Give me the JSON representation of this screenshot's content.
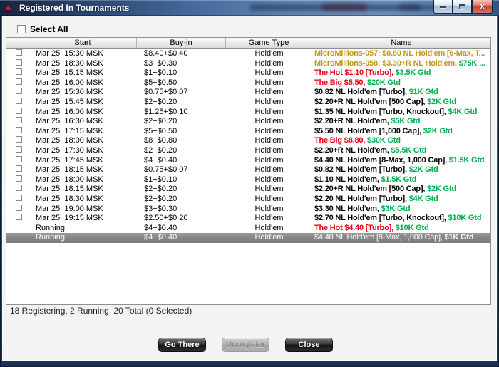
{
  "window": {
    "title": "Registered In Tournaments",
    "icon": "red-spade",
    "controls": {
      "minimize": "minimize",
      "maximize": "maximize",
      "close": "x"
    }
  },
  "select_all_label": "Select All",
  "table": {
    "columns": [
      "",
      "Start",
      "Buy-in",
      "Game Type",
      "Name"
    ],
    "rows": [
      {
        "checkbox": true,
        "selected": false,
        "start": "Mar 25  15:30 MSK",
        "buyin": "$8.40+$0.40",
        "game": "Hold'em",
        "name": [
          {
            "t": "MicroMillions-057: $8.80 NL Hold'em [6-Max, T...",
            "c": "gold"
          }
        ]
      },
      {
        "checkbox": true,
        "selected": false,
        "start": "Mar 25  18:30 MSK",
        "buyin": "$3+$0.30",
        "game": "Hold'em",
        "name": [
          {
            "t": "MicroMillions-058: $3.30+R NL Hold'em, ",
            "c": "gold"
          },
          {
            "t": "$75K ...",
            "c": "green"
          }
        ]
      },
      {
        "checkbox": true,
        "selected": false,
        "start": "Mar 25  15:15 MSK",
        "buyin": "$1+$0.10",
        "game": "Hold'em",
        "name": [
          {
            "t": "The Hot $1.10 [Turbo], ",
            "c": "red"
          },
          {
            "t": "$3.5K Gtd",
            "c": "green"
          }
        ]
      },
      {
        "checkbox": true,
        "selected": false,
        "start": "Mar 25  16:00 MSK",
        "buyin": "$5+$0.50",
        "game": "Hold'em",
        "name": [
          {
            "t": "The Big $5.50, ",
            "c": "red"
          },
          {
            "t": "$20K Gtd",
            "c": "green"
          }
        ]
      },
      {
        "checkbox": true,
        "selected": false,
        "start": "Mar 25  15:30 MSK",
        "buyin": "$0.75+$0.07",
        "game": "Hold'em",
        "name": [
          {
            "t": "$0.82 NL Hold'em [Turbo], ",
            "c": "black"
          },
          {
            "t": "$1K Gtd",
            "c": "green"
          }
        ]
      },
      {
        "checkbox": true,
        "selected": false,
        "start": "Mar 25  15:45 MSK",
        "buyin": "$2+$0.20",
        "game": "Hold'em",
        "name": [
          {
            "t": "$2.20+R NL Hold'em [500 Cap], ",
            "c": "black"
          },
          {
            "t": "$2K Gtd",
            "c": "green"
          }
        ]
      },
      {
        "checkbox": true,
        "selected": false,
        "start": "Mar 25  16:00 MSK",
        "buyin": "$1.25+$0.10",
        "game": "Hold'em",
        "name": [
          {
            "t": "$1.35 NL Hold'em [Turbo, Knockout], ",
            "c": "black"
          },
          {
            "t": "$4K Gtd",
            "c": "green"
          }
        ]
      },
      {
        "checkbox": true,
        "selected": false,
        "start": "Mar 25  16:30 MSK",
        "buyin": "$2+$0.20",
        "game": "Hold'em",
        "name": [
          {
            "t": "$2.20+R NL Hold'em, ",
            "c": "black"
          },
          {
            "t": "$5K Gtd",
            "c": "green"
          }
        ]
      },
      {
        "checkbox": true,
        "selected": false,
        "start": "Mar 25  17:15 MSK",
        "buyin": "$5+$0.50",
        "game": "Hold'em",
        "name": [
          {
            "t": "$5.50 NL Hold'em [1,000 Cap], ",
            "c": "black"
          },
          {
            "t": "$2K Gtd",
            "c": "green"
          }
        ]
      },
      {
        "checkbox": true,
        "selected": false,
        "start": "Mar 25  18:00 MSK",
        "buyin": "$8+$0.80",
        "game": "Hold'em",
        "name": [
          {
            "t": "The Big $8.80, ",
            "c": "red"
          },
          {
            "t": "$30K Gtd",
            "c": "green"
          }
        ]
      },
      {
        "checkbox": true,
        "selected": false,
        "start": "Mar 25  17:30 MSK",
        "buyin": "$2+$0.20",
        "game": "Hold'em",
        "name": [
          {
            "t": "$2.20+R NL Hold'em, ",
            "c": "black"
          },
          {
            "t": "$5.5K Gtd",
            "c": "green"
          }
        ]
      },
      {
        "checkbox": true,
        "selected": false,
        "start": "Mar 25  17:45 MSK",
        "buyin": "$4+$0.40",
        "game": "Hold'em",
        "name": [
          {
            "t": "$4.40 NL Hold'em [8-Max, 1,000 Cap], ",
            "c": "black"
          },
          {
            "t": "$1.5K Gtd",
            "c": "green"
          }
        ]
      },
      {
        "checkbox": true,
        "selected": false,
        "start": "Mar 25  18:15 MSK",
        "buyin": "$0.75+$0.07",
        "game": "Hold'em",
        "name": [
          {
            "t": "$0.82 NL Hold'em [Turbo], ",
            "c": "black"
          },
          {
            "t": "$2K Gtd",
            "c": "green"
          }
        ]
      },
      {
        "checkbox": true,
        "selected": false,
        "start": "Mar 25  18:00 MSK",
        "buyin": "$1+$0.10",
        "game": "Hold'em",
        "name": [
          {
            "t": "$1.10 NL Hold'em, ",
            "c": "black"
          },
          {
            "t": "$1.5K Gtd",
            "c": "green"
          }
        ]
      },
      {
        "checkbox": true,
        "selected": false,
        "start": "Mar 25  18:15 MSK",
        "buyin": "$2+$0.20",
        "game": "Hold'em",
        "name": [
          {
            "t": "$2.20+R NL Hold'em [500 Cap], ",
            "c": "black"
          },
          {
            "t": "$2K Gtd",
            "c": "green"
          }
        ]
      },
      {
        "checkbox": true,
        "selected": false,
        "start": "Mar 25  18:30 MSK",
        "buyin": "$2+$0.20",
        "game": "Hold'em",
        "name": [
          {
            "t": "$2.20 NL Hold'em [Turbo], ",
            "c": "black"
          },
          {
            "t": "$4K Gtd",
            "c": "green"
          }
        ]
      },
      {
        "checkbox": true,
        "selected": false,
        "start": "Mar 25  19:00 MSK",
        "buyin": "$3+$0.30",
        "game": "Hold'em",
        "name": [
          {
            "t": "$3.30 NL Hold'em, ",
            "c": "black"
          },
          {
            "t": "$3K Gtd",
            "c": "green"
          }
        ]
      },
      {
        "checkbox": true,
        "selected": false,
        "start": "Mar 25  19:15 MSK",
        "buyin": "$2.50+$0.20",
        "game": "Hold'em",
        "name": [
          {
            "t": "$2.70 NL Hold'em [Turbo, Knockout], ",
            "c": "black"
          },
          {
            "t": "$10K Gtd",
            "c": "green"
          }
        ]
      },
      {
        "checkbox": false,
        "selected": false,
        "start": "Running",
        "buyin": "$4+$0.40",
        "game": "Hold'em",
        "name": [
          {
            "t": "The Hot $4.40 [Turbo], ",
            "c": "red"
          },
          {
            "t": "$10K Gtd",
            "c": "green"
          }
        ]
      },
      {
        "checkbox": false,
        "selected": true,
        "start": "Running",
        "buyin": "$4+$0.40",
        "game": "Hold'em",
        "name": [
          {
            "t": "$4.40 NL Hold'em [8-Max, 1,000 Cap], ",
            "c": "white"
          },
          {
            "t": "$1K Gtd",
            "c": "whitebold"
          }
        ]
      }
    ]
  },
  "status": "18 Registering, 2 Running, 20 Total (0 Selected)",
  "buttons": [
    {
      "label": "Go There",
      "enabled": true
    },
    {
      "label": "Unregister",
      "enabled": false
    },
    {
      "label": "Close",
      "enabled": true
    }
  ],
  "colors": {
    "name_gold": "#c1971b",
    "name_red": "#e60013",
    "name_green": "#00ae4d",
    "selected_row_bg": "#858585",
    "titlebar_blue": "#5f86b5",
    "spade_red": "#d01f2e"
  }
}
